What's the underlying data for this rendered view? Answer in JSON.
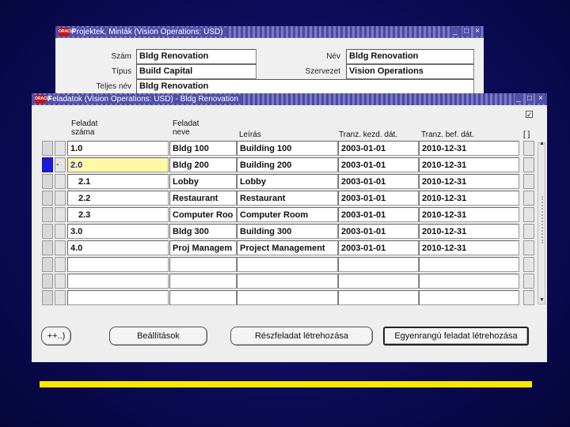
{
  "window_back": {
    "title": "Projektek, Minták (Vision Operations: USD)",
    "fields": {
      "szam_label": "Szám",
      "szam_value": "Bldg Renovation",
      "nev_label": "Név",
      "nev_value": "Bldg Renovation",
      "tipus_label": "Típus",
      "tipus_value": "Build Capital",
      "szervezet_label": "Szervezet",
      "szervezet_value": "Vision Operations",
      "teljes_nev_label": "Teljes név",
      "teljes_nev_value": "Bldg Renovation"
    }
  },
  "window_front": {
    "title": "Feladatok (Vision Operations: USD) - Bldg Renovation",
    "headers": {
      "col1": "Feladat\nszáma",
      "col2": "Feladat\nneve",
      "col3": "Leírás",
      "col4": "Tranz. kezd. dát.",
      "col5": "Tranz. bef. dát.",
      "col6": "[ ]"
    },
    "rows": [
      {
        "num": "1.0",
        "name": "Bldg 100",
        "desc": "Building 100",
        "start": "2003-01-01",
        "end": "2010-12-31"
      },
      {
        "num": "2.0",
        "name": "Bldg 200",
        "desc": "Building 200",
        "start": "2003-01-01",
        "end": "2010-12-31",
        "marker": "-"
      },
      {
        "num": "2.1",
        "name": "Lobby",
        "desc": "Lobby",
        "start": "2003-01-01",
        "end": "2010-12-31"
      },
      {
        "num": "2.2",
        "name": "Restaurant",
        "desc": "Restaurant",
        "start": "2003-01-01",
        "end": "2010-12-31"
      },
      {
        "num": "2.3",
        "name": "Computer Roo",
        "desc": "Computer Room",
        "start": "2003-01-01",
        "end": "2010-12-31"
      },
      {
        "num": "3.0",
        "name": "Bldg 300",
        "desc": "Building 300",
        "start": "2003-01-01",
        "end": "2010-12-31"
      },
      {
        "num": "4.0",
        "name": "Proj Managem",
        "desc": "Project Management",
        "start": "2003-01-01",
        "end": "2010-12-31"
      }
    ],
    "buttons": {
      "expand": "++..)",
      "settings": "Beállítások",
      "create_sub": "Részfeladat létrehozása",
      "create_peer": "Egyenrangú feladat létrehozása"
    }
  },
  "colors": {
    "background": "#0c0c5a",
    "accent_bar": "#f8e800",
    "titlebar": "#5a5ab0",
    "selected_row": "#1a1adb"
  },
  "icons": [
    "oracle-logo-icon",
    "minimize-icon",
    "maximize-icon",
    "close-icon",
    "scroll-up-icon",
    "scroll-down-icon"
  ]
}
